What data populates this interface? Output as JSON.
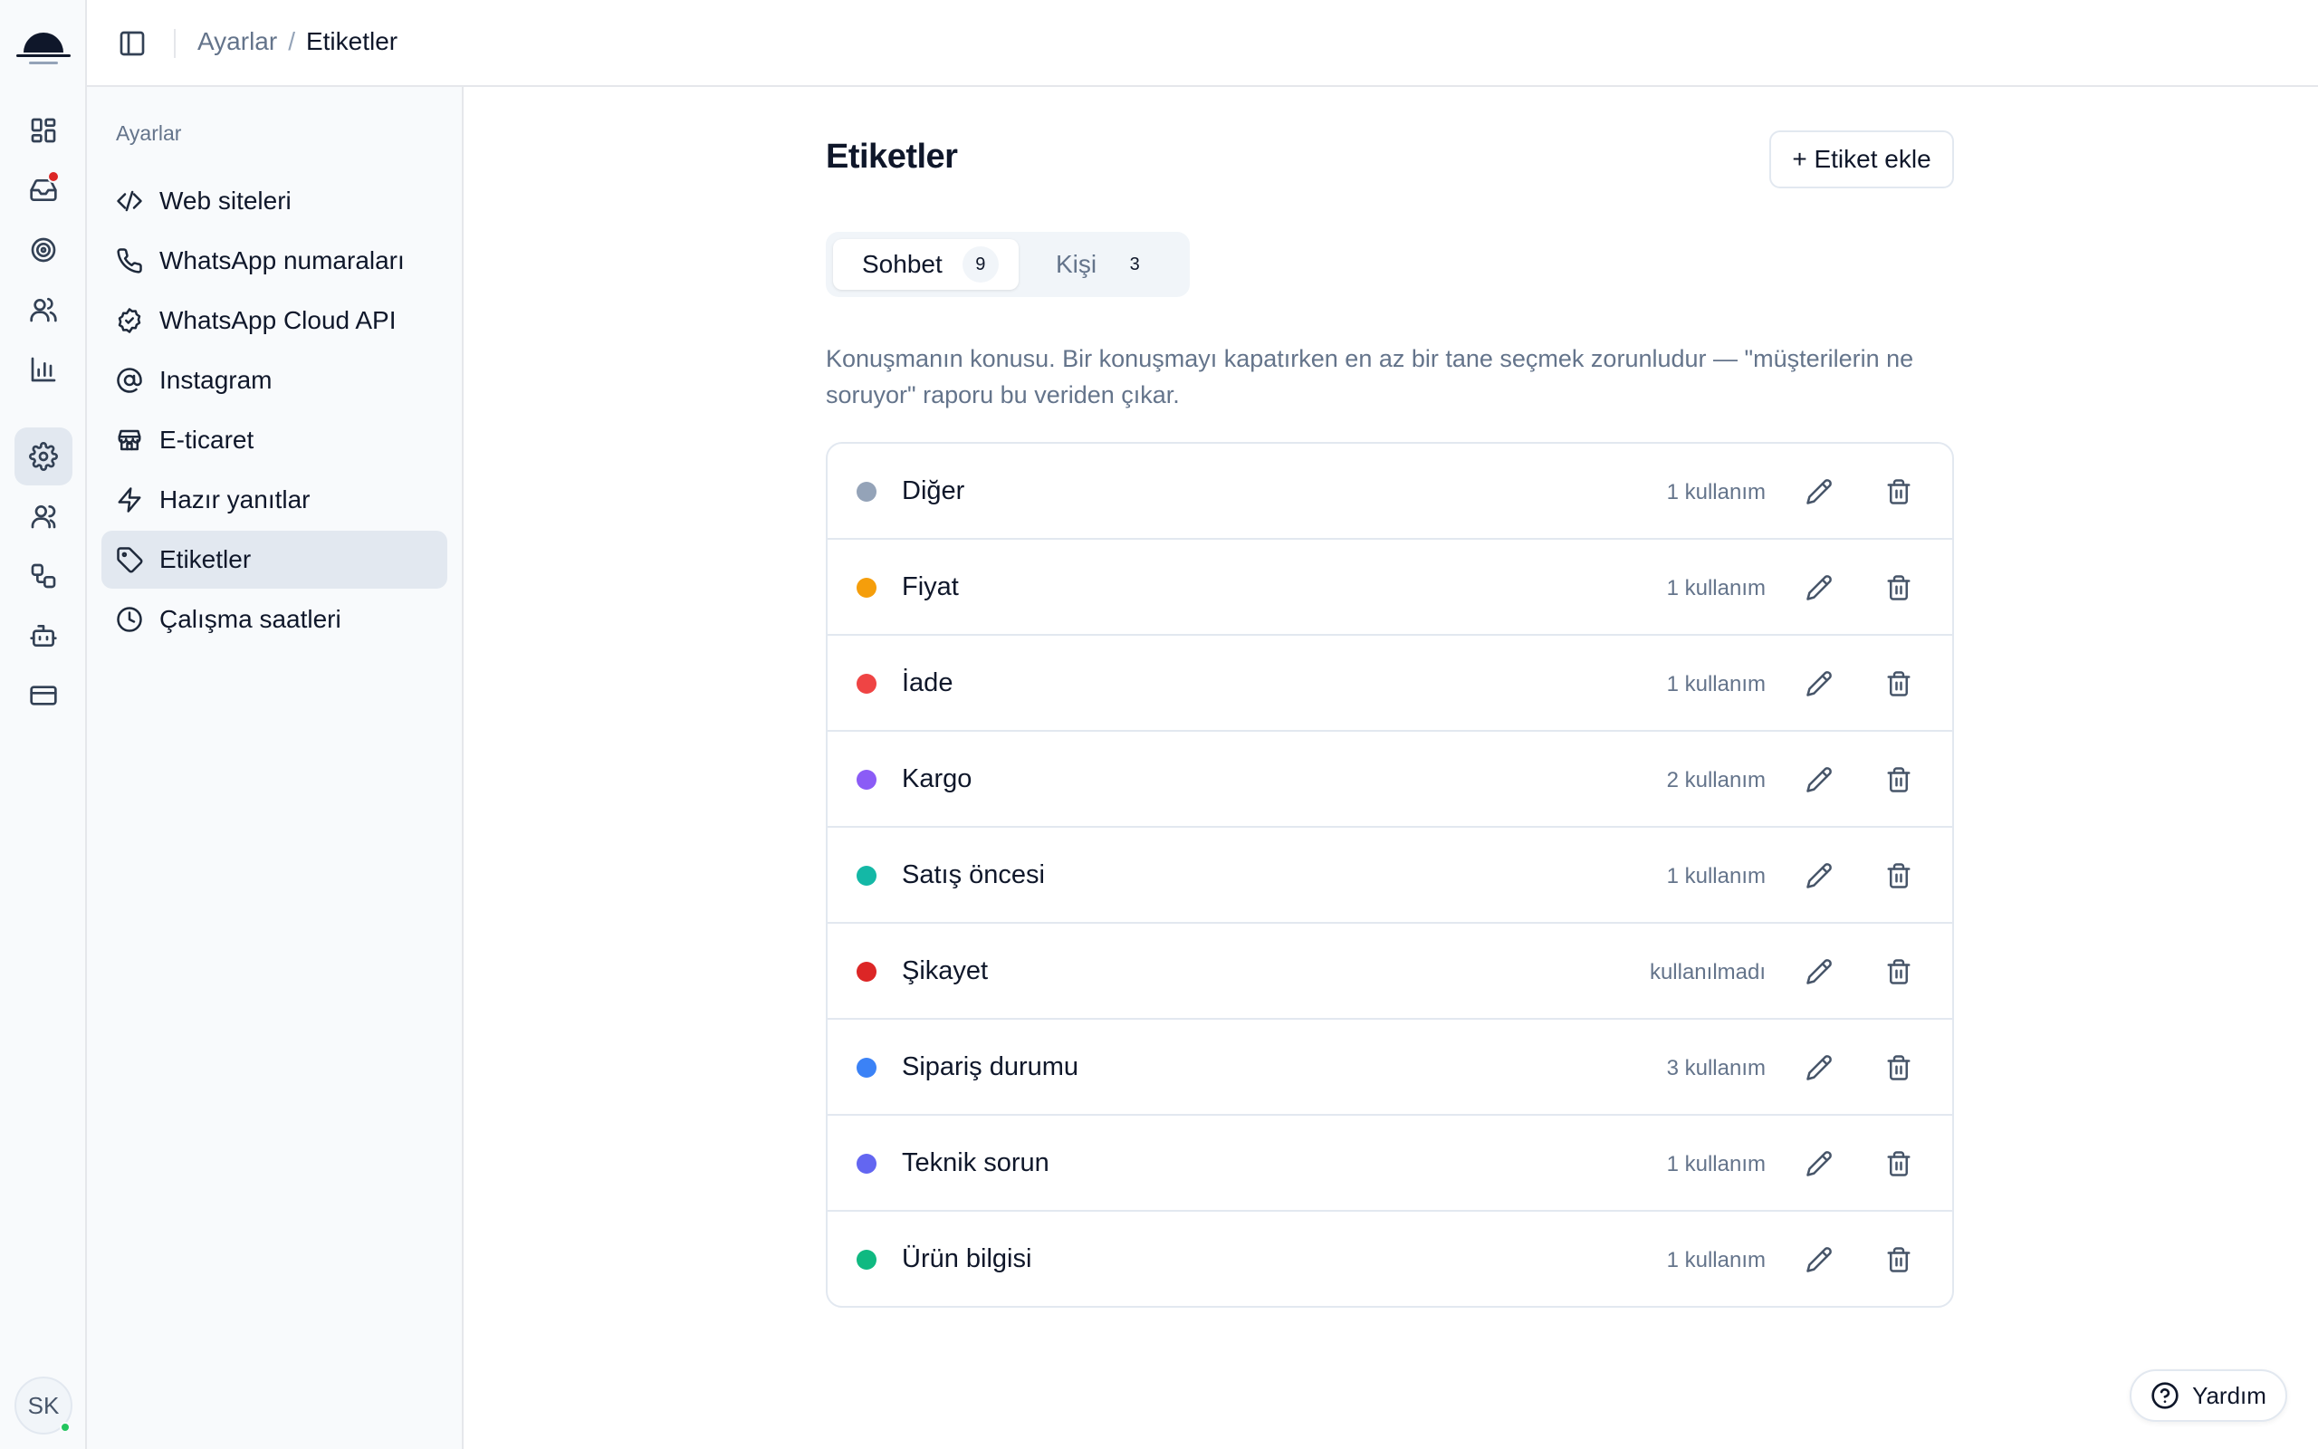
{
  "header": {
    "breadcrumb": [
      "Ayarlar",
      "/",
      "Etiketler"
    ]
  },
  "rail": {
    "items": [
      {
        "icon": "dashboard-icon"
      },
      {
        "icon": "inbox-icon",
        "has_notification": true
      },
      {
        "icon": "target-icon"
      },
      {
        "icon": "contacts-icon"
      },
      {
        "icon": "analytics-icon"
      },
      {
        "icon": "settings-icon",
        "active": true
      },
      {
        "icon": "team-icon"
      },
      {
        "icon": "workflow-icon"
      },
      {
        "icon": "bot-icon"
      },
      {
        "icon": "billing-icon"
      }
    ],
    "avatar_initials": "SK"
  },
  "sidebar": {
    "title": "Ayarlar",
    "items": [
      {
        "label": "Web siteleri",
        "icon": "code-icon"
      },
      {
        "label": "WhatsApp numaraları",
        "icon": "phone-icon"
      },
      {
        "label": "WhatsApp Cloud API",
        "icon": "verified-icon"
      },
      {
        "label": "Instagram",
        "icon": "at-sign-icon"
      },
      {
        "label": "E-ticaret",
        "icon": "store-icon"
      },
      {
        "label": "Hazır yanıtlar",
        "icon": "zap-icon"
      },
      {
        "label": "Etiketler",
        "icon": "tag-icon",
        "active": true
      },
      {
        "label": "Çalışma saatleri",
        "icon": "clock-icon"
      }
    ]
  },
  "main": {
    "title": "Etiketler",
    "add_button": "+ Etiket ekle",
    "tabs": [
      {
        "label": "Sohbet",
        "count": "9",
        "active": true
      },
      {
        "label": "Kişi",
        "count": "3",
        "active": false
      }
    ],
    "description": "Konuşmanın konusu. Bir konuşmayı kapatırken en az bir tane seçmek zorunludur — \"müşterilerin ne soruyor\" raporu bu veriden çıkar.",
    "tags": [
      {
        "name": "Diğer",
        "usage": "1 kullanım",
        "color": "#94a3b8"
      },
      {
        "name": "Fiyat",
        "usage": "1 kullanım",
        "color": "#f59e0b"
      },
      {
        "name": "İade",
        "usage": "1 kullanım",
        "color": "#ef4444"
      },
      {
        "name": "Kargo",
        "usage": "2 kullanım",
        "color": "#8b5cf6"
      },
      {
        "name": "Satış öncesi",
        "usage": "1 kullanım",
        "color": "#14b8a6"
      },
      {
        "name": "Şikayet",
        "usage": "kullanılmadı",
        "color": "#dc2626"
      },
      {
        "name": "Sipariş durumu",
        "usage": "3 kullanım",
        "color": "#3b82f6"
      },
      {
        "name": "Teknik sorun",
        "usage": "1 kullanım",
        "color": "#6366f1"
      },
      {
        "name": "Ürün bilgisi",
        "usage": "1 kullanım",
        "color": "#10b981"
      }
    ]
  },
  "help_button": "Yardım"
}
